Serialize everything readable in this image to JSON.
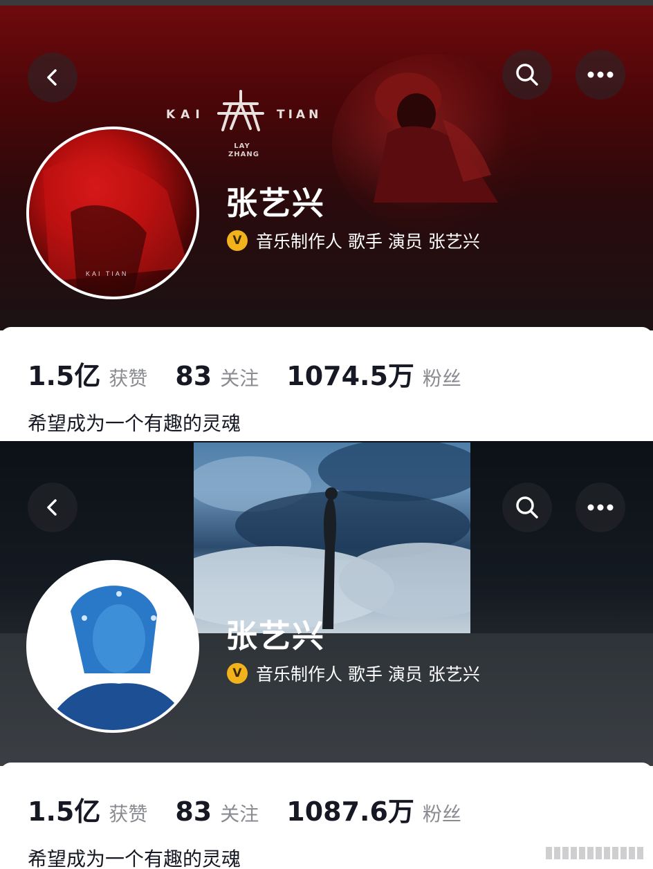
{
  "profiles": [
    {
      "name": "张艺兴",
      "verification": "音乐制作人 歌手 演员 张艺兴",
      "badge": "V",
      "banner_logo": {
        "left": "KAI",
        "right": "TIAN",
        "sub": "LAY ZHANG"
      },
      "stats": [
        {
          "value": "1.5亿",
          "label": "获赞"
        },
        {
          "value": "83",
          "label": "关注"
        },
        {
          "value": "1074.5万",
          "label": "粉丝"
        }
      ],
      "bio": "希望成为一个有趣的灵魂",
      "theme": {
        "banner": "#4a0608",
        "avatar": "#b10d0d"
      }
    },
    {
      "name": "张艺兴",
      "verification": "音乐制作人 歌手 演员 张艺兴",
      "badge": "V",
      "stats": [
        {
          "value": "1.5亿",
          "label": "获赞"
        },
        {
          "value": "83",
          "label": "关注"
        },
        {
          "value": "1087.6万",
          "label": "粉丝"
        }
      ],
      "bio": "希望成为一个有趣的灵魂",
      "theme": {
        "banner": "#141a21",
        "avatar": "#2f7fc9"
      }
    }
  ],
  "icons": {
    "back": "chevron-left-icon",
    "search": "search-icon",
    "more": "more-dots-icon",
    "verified": "verified-badge-icon"
  },
  "colors": {
    "badge": "#f2b21b",
    "text": "#161823",
    "muted": "#8a8b91"
  }
}
